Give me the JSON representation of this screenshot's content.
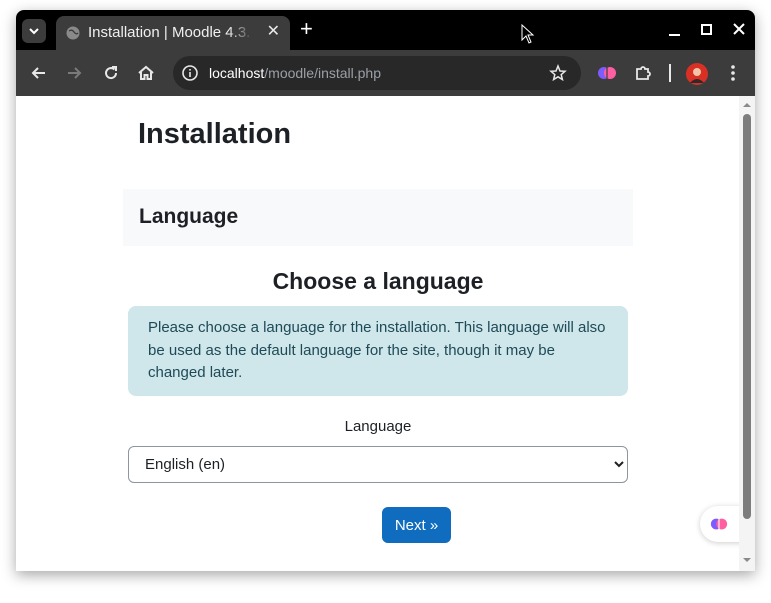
{
  "browser": {
    "tab_title": "Installation | Moodle 4.3.",
    "tab_close": "✕",
    "new_tab": "+",
    "url_host": "localhost",
    "url_path": "/moodle/install.php"
  },
  "page": {
    "title": "Installation",
    "section_heading": "Language",
    "choose_heading": "Choose a language",
    "info_text": "Please choose a language for the installation. This language will also be used as the default language for the site, though it may be changed later.",
    "language_label": "Language",
    "language_selected": "English (en)",
    "next_button": "Next »"
  },
  "icons": {
    "back": "back-arrow-icon",
    "forward": "forward-arrow-icon",
    "reload": "reload-icon",
    "home": "home-icon",
    "site_info": "info-icon",
    "bookmark": "star-icon",
    "extensions": "puzzle-icon",
    "menu": "kebab-menu-icon"
  },
  "colors": {
    "primary_button": "#0f6cbf",
    "info_alert_bg": "#cfe6ea",
    "section_bg": "#f8f9fa"
  }
}
